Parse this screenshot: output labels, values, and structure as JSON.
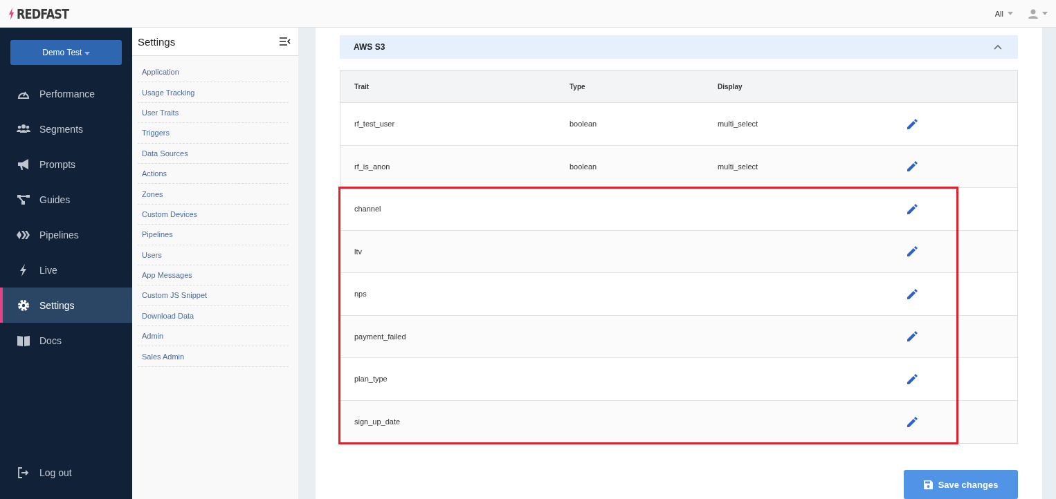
{
  "header": {
    "logo": "REDFAST",
    "filter": "All"
  },
  "sidebar": {
    "account": "Demo Test",
    "items": [
      {
        "label": "Performance",
        "selected": false
      },
      {
        "label": "Segments",
        "selected": false
      },
      {
        "label": "Prompts",
        "selected": false
      },
      {
        "label": "Guides",
        "selected": false
      },
      {
        "label": "Pipelines",
        "selected": false
      },
      {
        "label": "Live",
        "selected": false
      },
      {
        "label": "Settings",
        "selected": true
      },
      {
        "label": "Docs",
        "selected": false
      }
    ],
    "logout": "Log out"
  },
  "settings_nav": {
    "title": "Settings",
    "items": [
      "Application",
      "Usage Tracking",
      "User Traits",
      "Triggers",
      "Data Sources",
      "Actions",
      "Zones",
      "Custom Devices",
      "Pipelines",
      "Users",
      "App Messages",
      "Custom JS Snippet",
      "Download Data",
      "Admin",
      "Sales Admin"
    ]
  },
  "section": {
    "title": "AWS S3",
    "expanded": true
  },
  "table": {
    "columns": [
      "Trait",
      "Type",
      "Display"
    ],
    "rows": [
      {
        "trait": "rf_test_user",
        "type": "boolean",
        "display": "multi_select",
        "highlighted": false
      },
      {
        "trait": "rf_is_anon",
        "type": "boolean",
        "display": "multi_select",
        "highlighted": false
      },
      {
        "trait": "channel",
        "highlighted": true
      },
      {
        "trait": "ltv",
        "highlighted": true
      },
      {
        "trait": "nps",
        "highlighted": true
      },
      {
        "trait": "payment_failed",
        "highlighted": true
      },
      {
        "trait": "plan_type",
        "highlighted": true
      },
      {
        "trait": "sign_up_date",
        "highlighted": true
      }
    ]
  },
  "save_button": "Save changes"
}
